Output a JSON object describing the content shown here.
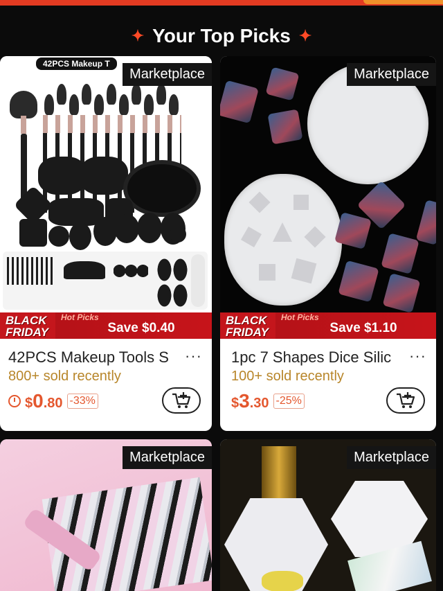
{
  "header": {
    "title": "Your Top Picks"
  },
  "products": [
    {
      "badge": "Marketplace",
      "image_label": "42PCS Makeup T",
      "promo_label": "BLACK FRIDAY",
      "promo_tag": "Hot Picks",
      "save": "Save $0.40",
      "title": "42PCS Makeup Tools S",
      "sold": "800+ sold recently",
      "price_currency": "$",
      "price_int": "0",
      "price_dec": ".80",
      "discount": "-33%"
    },
    {
      "badge": "Marketplace",
      "promo_label": "BLACK FRIDAY",
      "promo_tag": "Hot Picks",
      "save": "Save $1.10",
      "title": "1pc 7 Shapes Dice Silic",
      "sold": "100+ sold recently",
      "price_currency": "$",
      "price_int": "3",
      "price_dec": ".30",
      "discount": "-25%"
    },
    {
      "badge": "Marketplace"
    },
    {
      "badge": "Marketplace"
    }
  ],
  "more_glyph": "···",
  "icons": [
    "clock-icon",
    "add-to-cart-icon",
    "sparkle-icon"
  ],
  "colors": {
    "accent": "#e4572e",
    "promo_red": "#c4161c",
    "sold": "#b8862a"
  }
}
